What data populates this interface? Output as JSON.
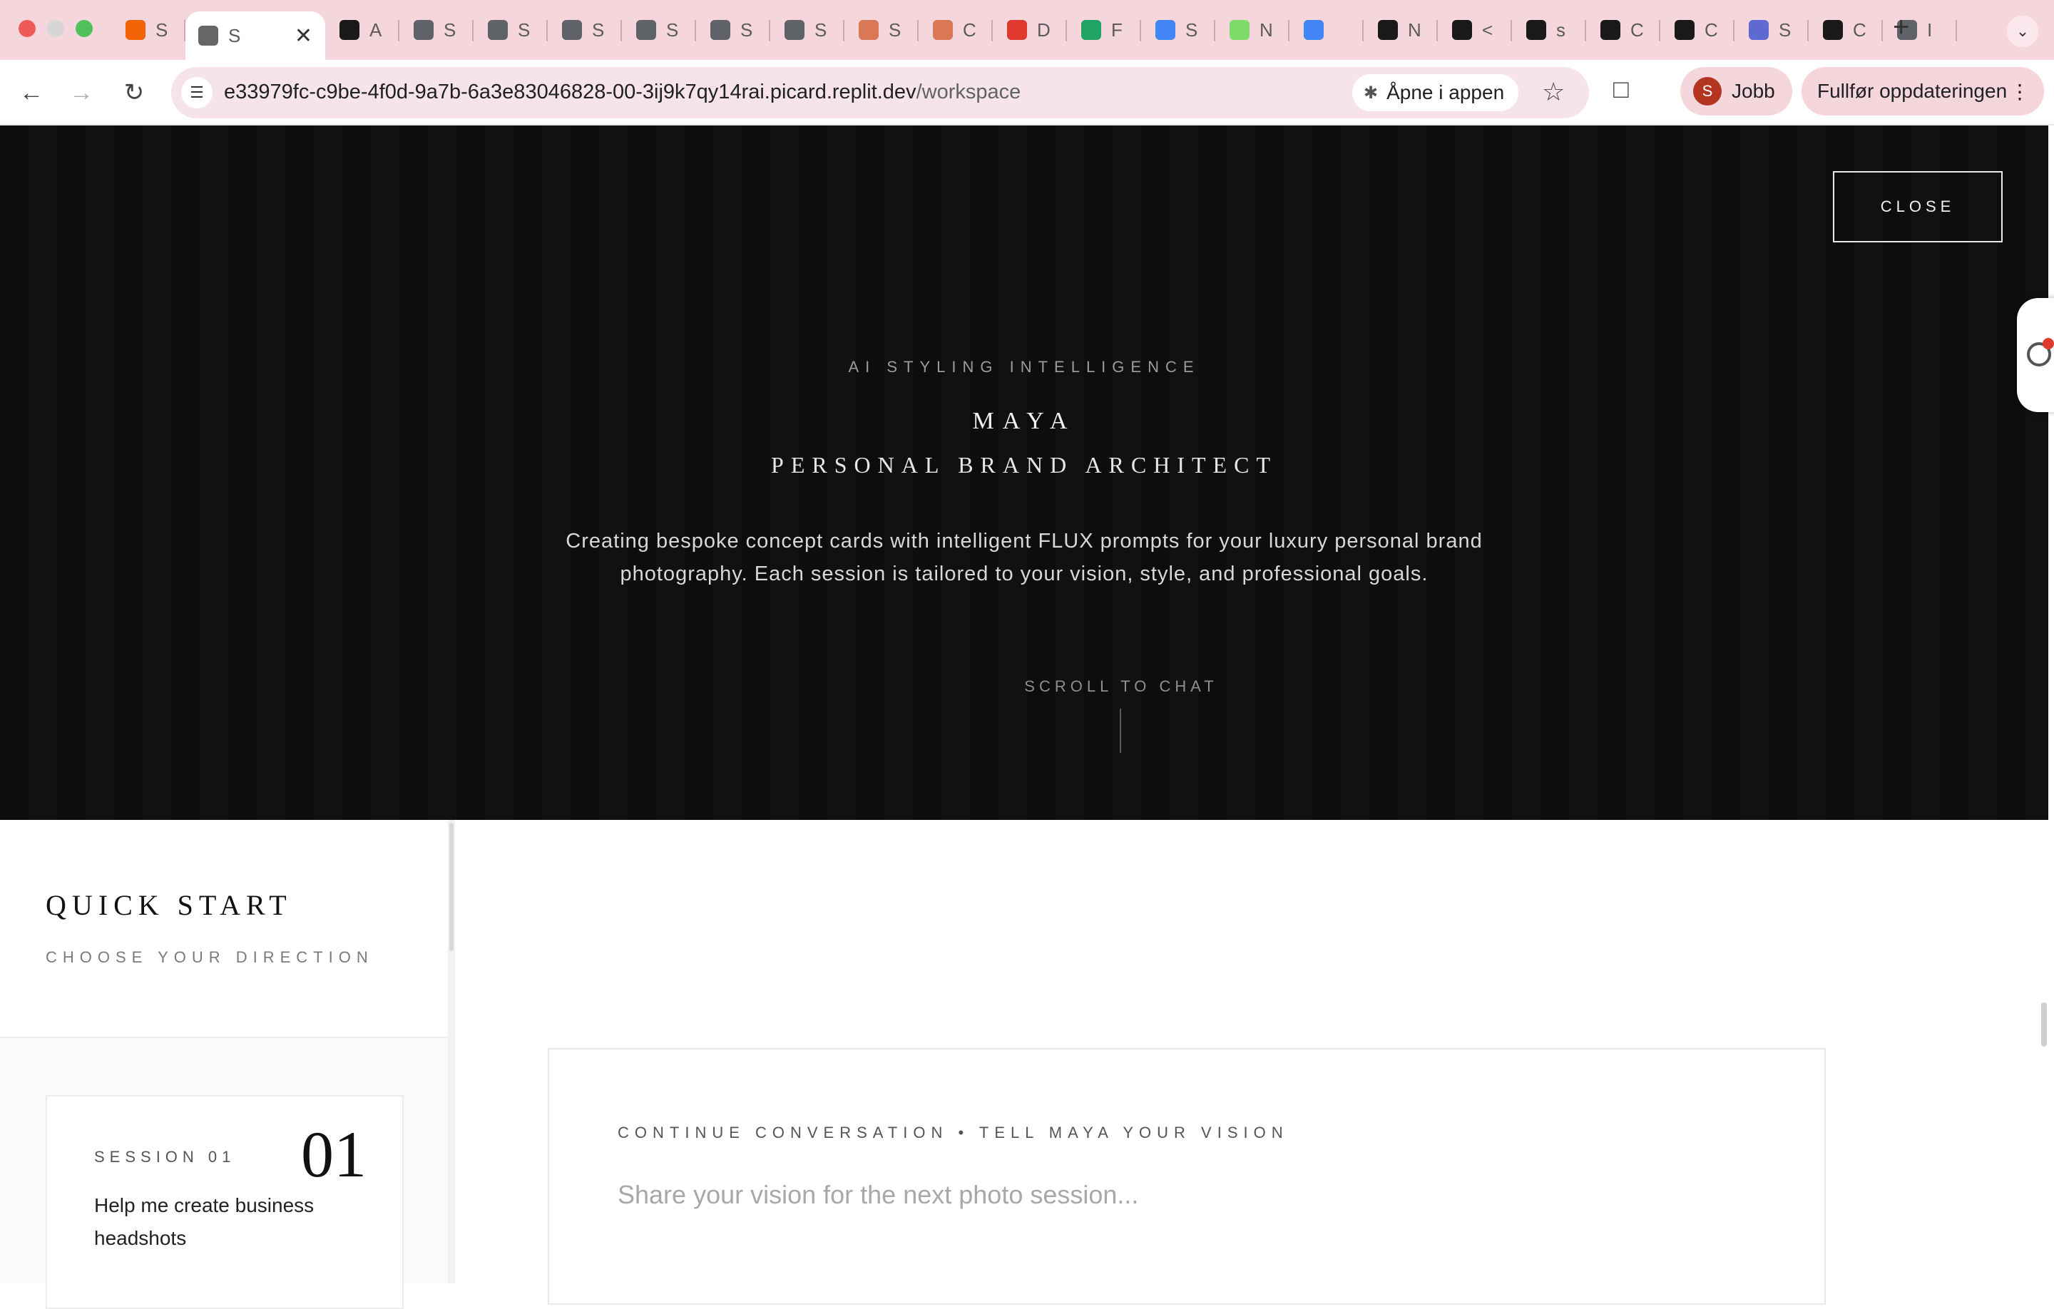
{
  "browser": {
    "tabs": [
      {
        "letter": "S",
        "favicon": "replit-icon",
        "color": "#f26207"
      },
      {
        "letter": "S",
        "favicon": "page-icon",
        "color": "#666666",
        "active": true
      },
      {
        "letter": "A",
        "favicon": "lp-icon",
        "color": "#1a1a1a"
      },
      {
        "letter": "S",
        "favicon": "globe-icon",
        "color": "#5f6368"
      },
      {
        "letter": "S",
        "favicon": "globe-icon",
        "color": "#5f6368"
      },
      {
        "letter": "S",
        "favicon": "globe-icon",
        "color": "#5f6368"
      },
      {
        "letter": "S",
        "favicon": "globe-icon",
        "color": "#5f6368"
      },
      {
        "letter": "S",
        "favicon": "globe-icon",
        "color": "#5f6368"
      },
      {
        "letter": "S",
        "favicon": "globe-icon",
        "color": "#5f6368"
      },
      {
        "letter": "S",
        "favicon": "claude-icon",
        "color": "#d97757"
      },
      {
        "letter": "C",
        "favicon": "claude-icon",
        "color": "#d97757"
      },
      {
        "letter": "D",
        "favicon": "doc-red-icon",
        "color": "#e0392f"
      },
      {
        "letter": "F",
        "favicon": "drive-icon",
        "color": "#1fa463"
      },
      {
        "letter": "S",
        "favicon": "docs-icon",
        "color": "#4285f4"
      },
      {
        "letter": "N",
        "favicon": "n-icon",
        "color": "#7fdc6a"
      },
      {
        "letter": "",
        "favicon": "docs-icon",
        "color": "#4285f4"
      },
      {
        "letter": "N",
        "favicon": "notion-icon",
        "color": "#1a1a1a"
      },
      {
        "letter": "<",
        "favicon": "code-icon",
        "color": "#1a1a1a"
      },
      {
        "letter": "s",
        "favicon": "github-icon",
        "color": "#1a1a1a"
      },
      {
        "letter": "C",
        "favicon": "cube-icon",
        "color": "#1a1a1a"
      },
      {
        "letter": "C",
        "favicon": "cube-icon",
        "color": "#1a1a1a"
      },
      {
        "letter": "S",
        "favicon": "linear-icon",
        "color": "#5e6ad2"
      },
      {
        "letter": "C",
        "favicon": "cube-icon",
        "color": "#1a1a1a"
      },
      {
        "letter": "I",
        "favicon": "globe-icon",
        "color": "#5f6368"
      }
    ],
    "new_tab": "+",
    "tab_menu": "⌄",
    "url_main": "e33979fc-c9be-4f0d-9a7b-6a3e83046828-00-3ij9k7qy14rai.picard.replit.dev",
    "url_path": "/workspace",
    "open_in_app": "Åpne i appen",
    "profile_initial": "S",
    "profile_name": "Jobb",
    "update_label": "Fullfør oppdateringen"
  },
  "hero": {
    "close_label": "CLOSE",
    "eyebrow": "AI STYLING INTELLIGENCE",
    "name": "MAYA",
    "role": "PERSONAL BRAND ARCHITECT",
    "description_line1": "Creating bespoke concept cards with intelligent FLUX prompts for your luxury personal brand",
    "description_line2": "photography. Each session is tailored to your vision, style, and professional goals.",
    "scroll_label": "SCROLL TO CHAT"
  },
  "sidebar": {
    "title": "QUICK START",
    "subtitle": "CHOOSE YOUR DIRECTION",
    "sessions": [
      {
        "label": "SESSION 01",
        "number": "01",
        "text": "Help me create business headshots"
      }
    ]
  },
  "chat": {
    "label": "CONTINUE CONVERSATION • TELL MAYA YOUR VISION",
    "placeholder": "Share your vision for the next photo session..."
  },
  "colors": {
    "tab_strip": "#f6d6dd",
    "hero_bg": "#0a0a0a",
    "profile_avatar": "#b3341f"
  }
}
